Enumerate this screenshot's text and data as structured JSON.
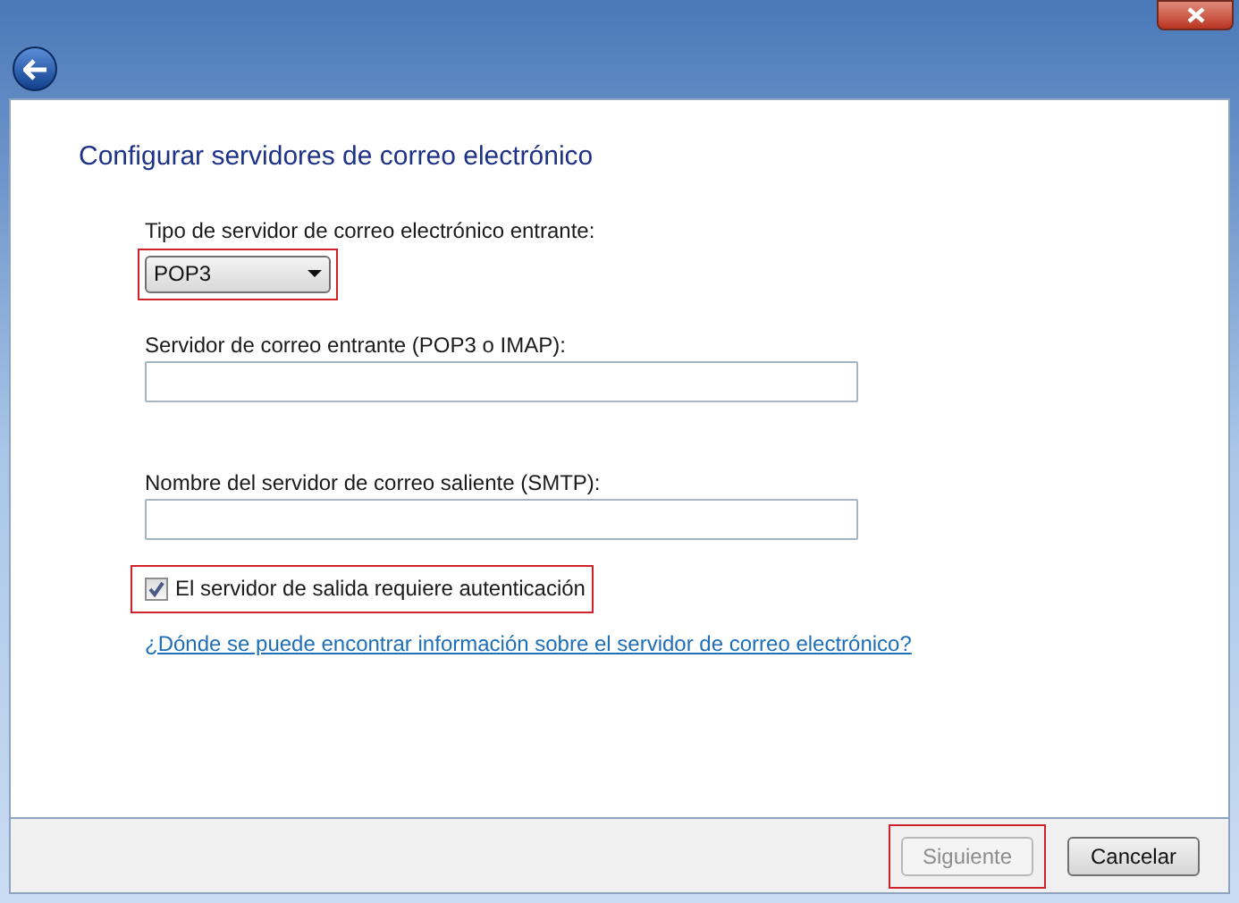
{
  "heading": "Configurar servidores de correo electrónico",
  "fields": [
    {
      "kind": "dropdown",
      "label": "Tipo de servidor de correo electrónico entrante:",
      "value": "POP3",
      "highlighted": true
    },
    {
      "kind": "text",
      "label": "Servidor de correo entrante (POP3 o IMAP):",
      "highlighted": false
    },
    {
      "kind": "text",
      "label": "Nombre del servidor de correo saliente (SMTP):",
      "highlighted": false
    }
  ],
  "auth_checkbox": {
    "label": "El servidor de salida requiere autenticación",
    "checked": true,
    "highlighted": true
  },
  "help_link": "¿Dónde se puede encontrar información sobre el servidor de correo electrónico?",
  "buttons": [
    {
      "label": "Siguiente",
      "disabled": true,
      "highlighted": true
    },
    {
      "label": "Cancelar",
      "disabled": false,
      "highlighted": false
    }
  ]
}
